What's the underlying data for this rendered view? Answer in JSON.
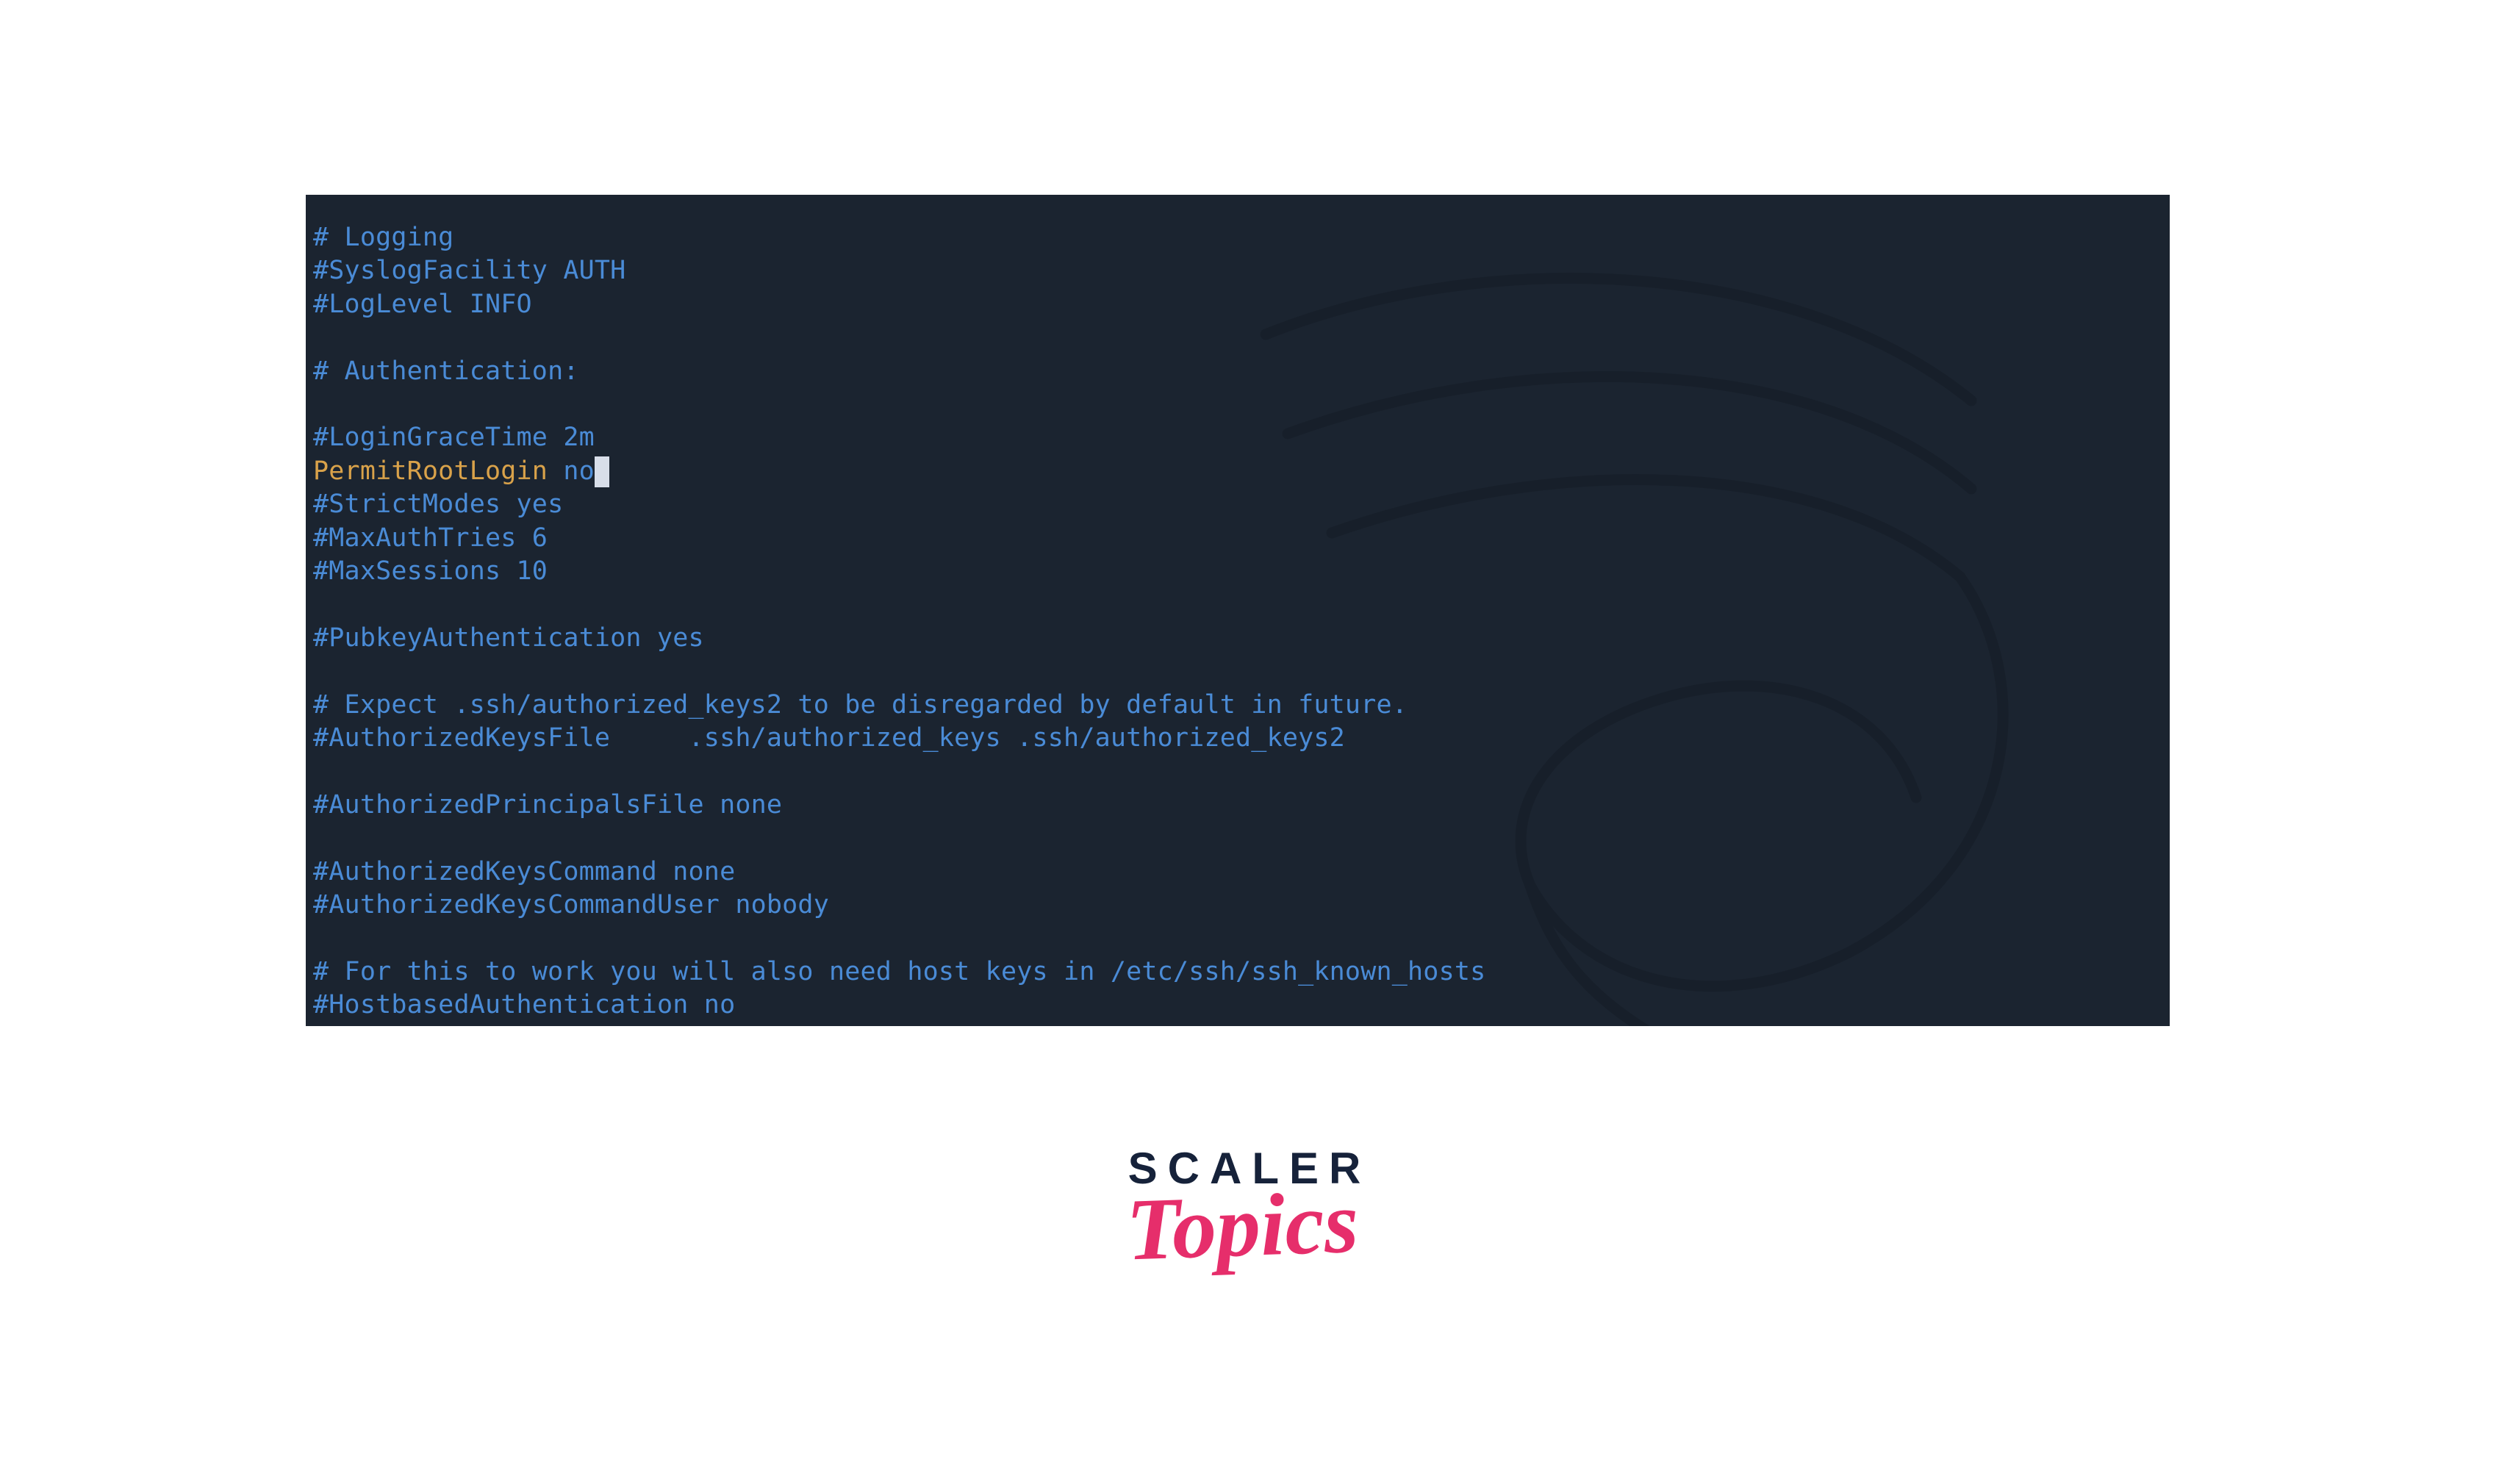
{
  "terminal": {
    "lines": [
      {
        "parts": [
          {
            "cls": "c-comment",
            "text": "# Logging"
          }
        ]
      },
      {
        "parts": [
          {
            "cls": "c-comment",
            "text": "#SyslogFacility AUTH"
          }
        ]
      },
      {
        "parts": [
          {
            "cls": "c-comment",
            "text": "#LogLevel INFO"
          }
        ]
      },
      {
        "parts": []
      },
      {
        "parts": [
          {
            "cls": "c-comment",
            "text": "# Authentication:"
          }
        ]
      },
      {
        "parts": []
      },
      {
        "parts": [
          {
            "cls": "c-comment",
            "text": "#LoginGraceTime 2m"
          }
        ]
      },
      {
        "parts": [
          {
            "cls": "c-key",
            "text": "PermitRootLogin "
          },
          {
            "cls": "c-comment",
            "text": "no"
          },
          {
            "cursor": true
          }
        ]
      },
      {
        "parts": [
          {
            "cls": "c-comment",
            "text": "#StrictModes yes"
          }
        ]
      },
      {
        "parts": [
          {
            "cls": "c-comment",
            "text": "#MaxAuthTries 6"
          }
        ]
      },
      {
        "parts": [
          {
            "cls": "c-comment",
            "text": "#MaxSessions 10"
          }
        ]
      },
      {
        "parts": []
      },
      {
        "parts": [
          {
            "cls": "c-comment",
            "text": "#PubkeyAuthentication yes"
          }
        ]
      },
      {
        "parts": []
      },
      {
        "parts": [
          {
            "cls": "c-comment",
            "text": "# Expect .ssh/authorized_keys2 to be disregarded by default in future."
          }
        ]
      },
      {
        "parts": [
          {
            "cls": "c-comment",
            "text": "#AuthorizedKeysFile     .ssh/authorized_keys .ssh/authorized_keys2"
          }
        ]
      },
      {
        "parts": []
      },
      {
        "parts": [
          {
            "cls": "c-comment",
            "text": "#AuthorizedPrincipalsFile none"
          }
        ]
      },
      {
        "parts": []
      },
      {
        "parts": [
          {
            "cls": "c-comment",
            "text": "#AuthorizedKeysCommand none"
          }
        ]
      },
      {
        "parts": [
          {
            "cls": "c-comment",
            "text": "#AuthorizedKeysCommandUser nobody"
          }
        ]
      },
      {
        "parts": []
      },
      {
        "parts": [
          {
            "cls": "c-comment",
            "text": "# For this to work you will also need host keys in /etc/ssh/ssh_known_hosts"
          }
        ]
      },
      {
        "parts": [
          {
            "cls": "c-comment",
            "text": "#HostbasedAuthentication no"
          }
        ]
      }
    ]
  },
  "logo": {
    "line1": "SCALER",
    "line2": "Topics"
  }
}
